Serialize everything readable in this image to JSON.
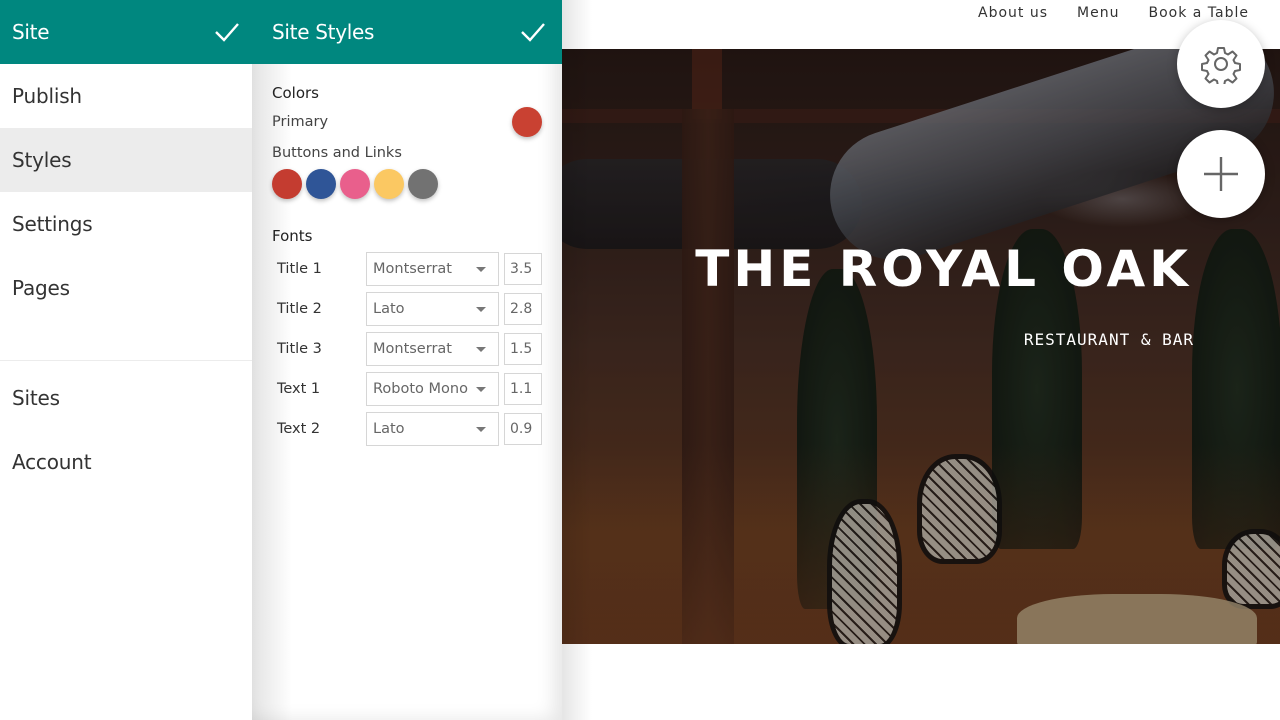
{
  "nav_panel": {
    "title": "Site",
    "confirm_icon": "check-icon",
    "items": [
      {
        "label": "Publish",
        "active": false
      },
      {
        "label": "Styles",
        "active": true
      },
      {
        "label": "Settings",
        "active": false
      },
      {
        "label": "Pages",
        "active": false
      }
    ],
    "secondary_items": [
      {
        "label": "Sites"
      },
      {
        "label": "Account"
      }
    ]
  },
  "styles_panel": {
    "title": "Site Styles",
    "confirm_icon": "check-icon",
    "colors": {
      "section_title": "Colors",
      "primary_label": "Primary",
      "primary_color": "#c94132",
      "buttons_links_label": "Buttons and Links",
      "buttons_links_swatches": [
        "#c43c30",
        "#2f5597",
        "#e95f8c",
        "#fbc862",
        "#727272"
      ]
    },
    "fonts": {
      "section_title": "Fonts",
      "rows": [
        {
          "label": "Title 1",
          "font": "Montserrat",
          "size": "3.5"
        },
        {
          "label": "Title 2",
          "font": "Lato",
          "size": "2.8"
        },
        {
          "label": "Title 3",
          "font": "Montserrat",
          "size": "1.5"
        },
        {
          "label": "Text 1",
          "font": "Roboto Mono",
          "size": "1.1"
        },
        {
          "label": "Text 2",
          "font": "Lato",
          "size": "0.9"
        }
      ]
    }
  },
  "preview": {
    "nav_links": [
      "About us",
      "Menu",
      "Book a Table"
    ],
    "hero_title": "THE ROYAL OAK",
    "hero_subtitle": "RESTAURANT & BAR",
    "fab_settings_icon": "gear-icon",
    "fab_add_icon": "plus-icon"
  }
}
